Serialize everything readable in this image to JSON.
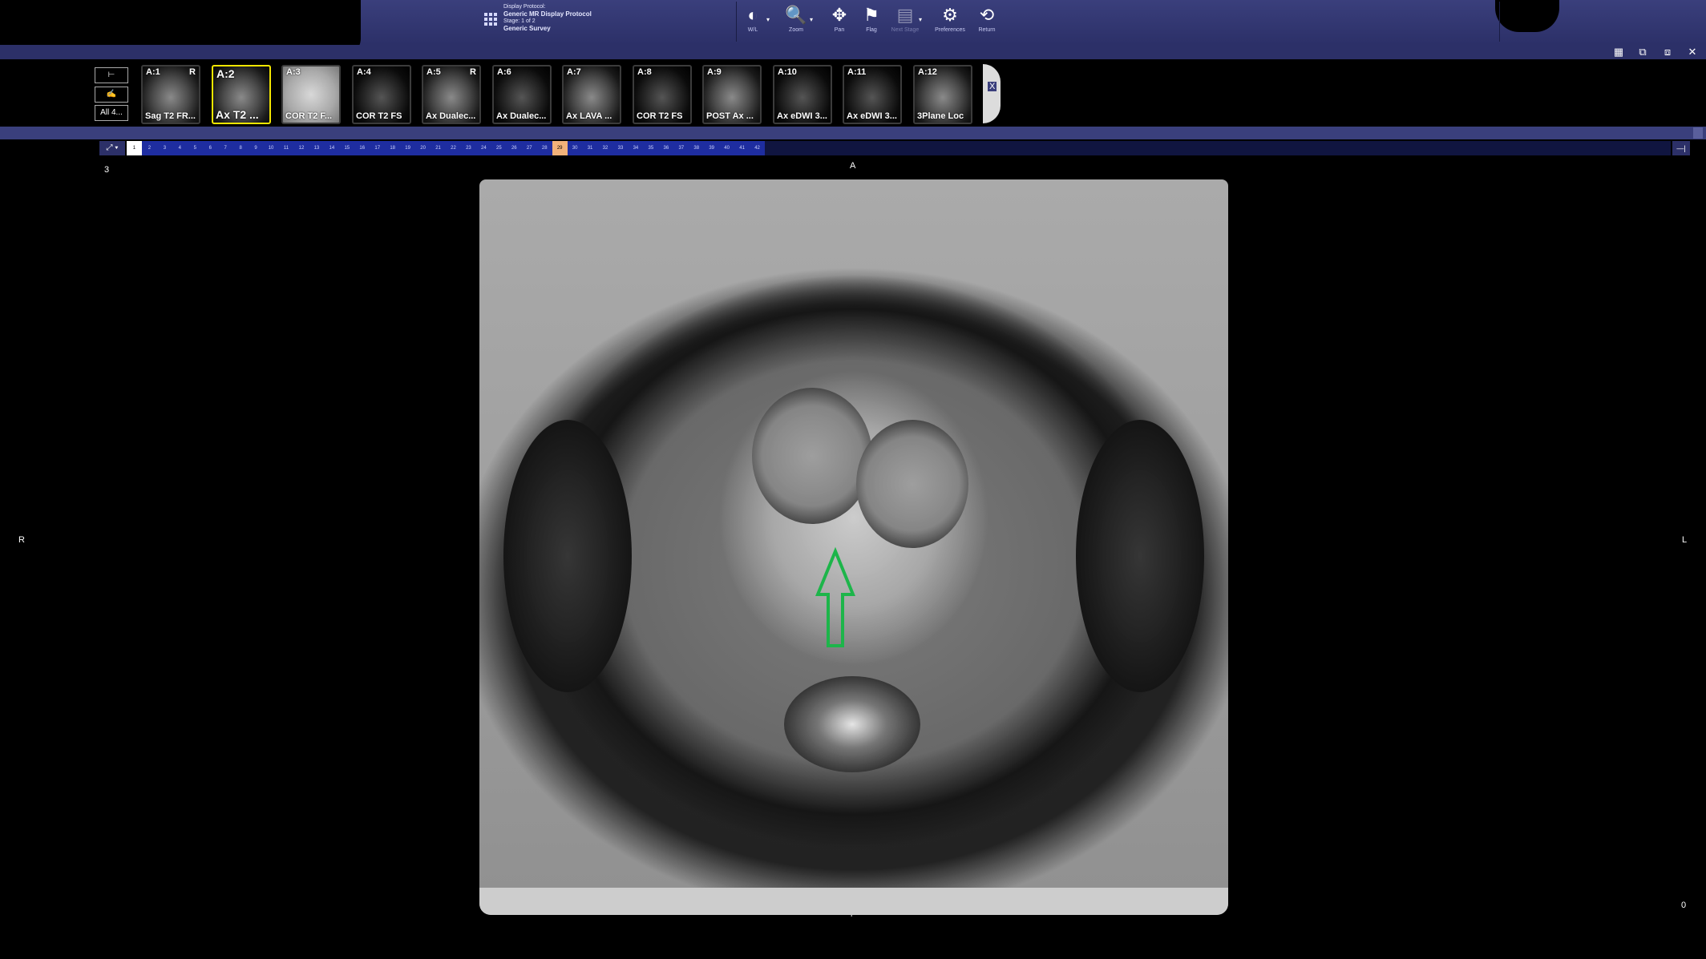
{
  "protocol": {
    "heading": "Display Protocol:",
    "name": "Generic MR Display Protocol",
    "stage": "Stage: 1 of 2",
    "survey": "Generic Survey"
  },
  "toolbar": {
    "tools": [
      {
        "label": "W/L",
        "icon": "window-level-icon",
        "glyph": "◐",
        "dropdown": true,
        "enabled": true
      },
      {
        "label": "Zoom",
        "icon": "zoom-icon",
        "glyph": "🔍",
        "dropdown": true,
        "enabled": true
      },
      {
        "label": "Pan",
        "icon": "pan-icon",
        "glyph": "✥",
        "dropdown": false,
        "enabled": true
      },
      {
        "label": "Flag",
        "icon": "flag-icon",
        "glyph": "⚑",
        "dropdown": false,
        "enabled": true
      },
      {
        "label": "Next Stage",
        "icon": "next-stage-icon",
        "glyph": "▤",
        "dropdown": true,
        "enabled": false
      },
      {
        "label": "Preferences",
        "icon": "preferences-icon",
        "glyph": "⚙",
        "dropdown": false,
        "enabled": true
      },
      {
        "label": "Return",
        "icon": "return-icon",
        "glyph": "⟲",
        "dropdown": false,
        "enabled": true
      }
    ]
  },
  "window_controls": {
    "layout": "▦",
    "restore": "⧉",
    "minimize": "⧈",
    "close": "✕"
  },
  "side_buttons": [
    "",
    "",
    "All 4..."
  ],
  "series": [
    {
      "id": "A:1",
      "name": "Sag T2 FR...",
      "flag": "R",
      "style": "normal"
    },
    {
      "id": "A:2",
      "name": "Ax T2 ...",
      "flag": "",
      "style": "selected"
    },
    {
      "id": "A:3",
      "name": "COR T2 F...",
      "flag": "",
      "style": "light"
    },
    {
      "id": "A:4",
      "name": "COR T2 FS",
      "flag": "",
      "style": "dark"
    },
    {
      "id": "A:5",
      "name": "Ax Dualec...",
      "flag": "R",
      "style": "normal"
    },
    {
      "id": "A:6",
      "name": "Ax Dualec...",
      "flag": "",
      "style": "dark"
    },
    {
      "id": "A:7",
      "name": "Ax LAVA ...",
      "flag": "",
      "style": "normal"
    },
    {
      "id": "A:8",
      "name": "COR T2 FS",
      "flag": "",
      "style": "dark"
    },
    {
      "id": "A:9",
      "name": "POST Ax ...",
      "flag": "",
      "style": "normal"
    },
    {
      "id": "A:10",
      "name": "Ax eDWI 3...",
      "flag": "",
      "style": "dark"
    },
    {
      "id": "A:11",
      "name": "Ax eDWI 3...",
      "flag": "",
      "style": "dark"
    },
    {
      "id": "A:12",
      "name": "3Plane Loc",
      "flag": "",
      "style": "normal"
    }
  ],
  "thumb_collapse_label": "X",
  "image_index": {
    "numbers": [
      "1",
      "2",
      "3",
      "4",
      "5",
      "6",
      "7",
      "8",
      "9",
      "10",
      "11",
      "12",
      "13",
      "14",
      "15",
      "16",
      "17",
      "18",
      "19",
      "20",
      "21",
      "22",
      "23",
      "24",
      "25",
      "26",
      "27",
      "28",
      "29",
      "30",
      "31",
      "32",
      "33",
      "34",
      "35",
      "36",
      "37",
      "38",
      "39",
      "40",
      "41",
      "42"
    ],
    "current": "29",
    "tool_glyph": "⤢ ▾",
    "end_glyph": "—|"
  },
  "viewport": {
    "image_number": "3",
    "orientation": {
      "top": "A",
      "left": "R",
      "right": "L",
      "bottom": "P"
    },
    "corner_bottom_right": "0",
    "annotation_color": "#1db54a"
  }
}
